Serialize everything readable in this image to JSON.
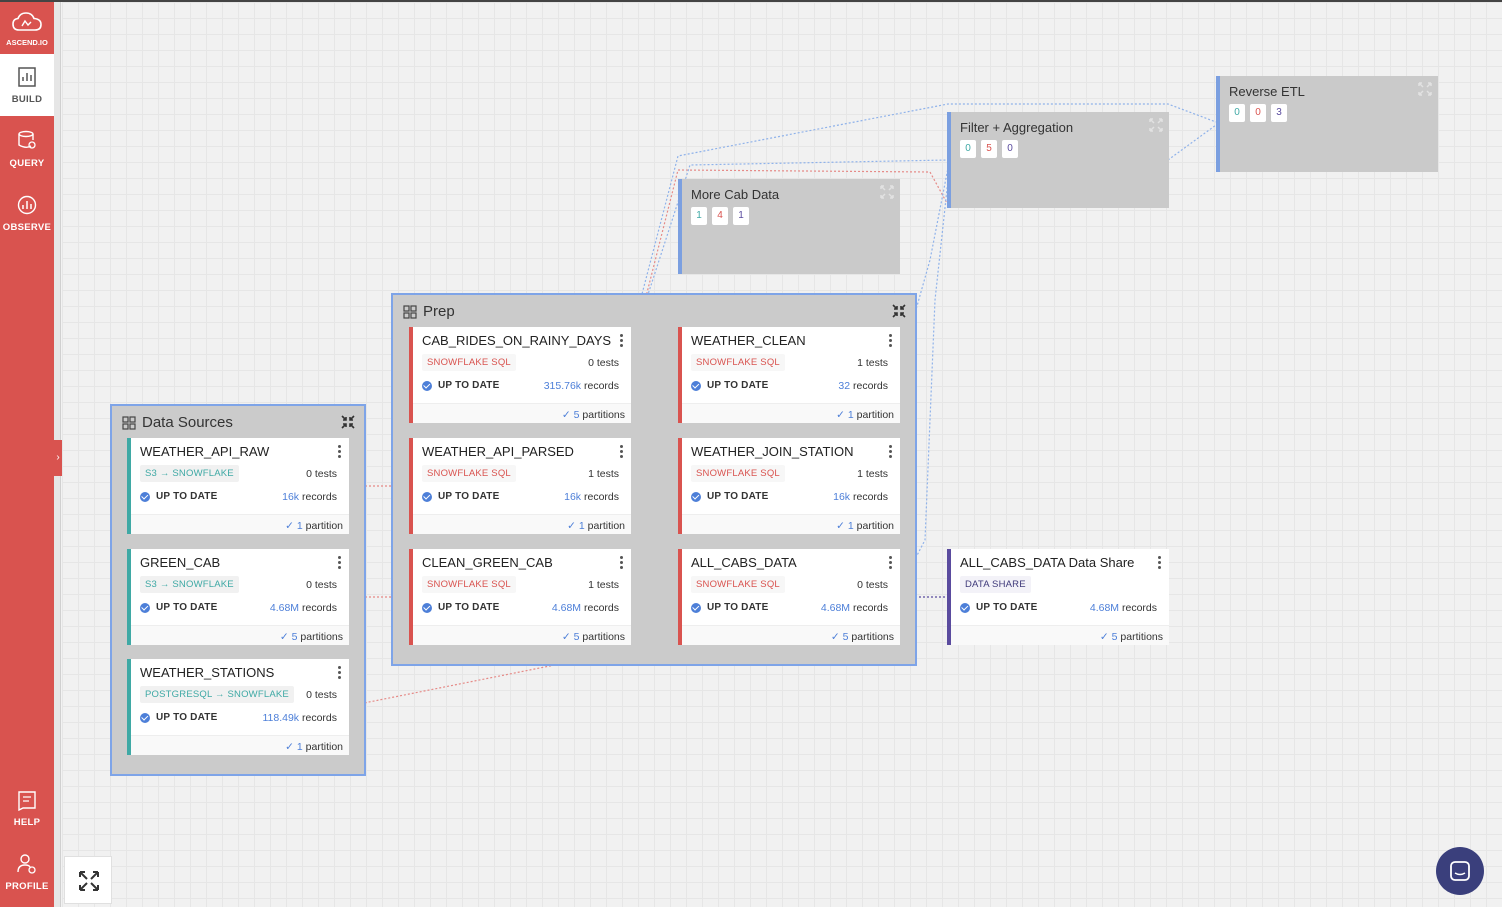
{
  "sidebar": {
    "logo_label": "ASCEND.IO",
    "items": [
      {
        "label": "BUILD",
        "icon": "build-icon"
      },
      {
        "label": "QUERY",
        "icon": "query-icon"
      },
      {
        "label": "OBSERVE",
        "icon": "observe-icon"
      },
      {
        "label": "HELP",
        "icon": "help-icon"
      },
      {
        "label": "PROFILE",
        "icon": "profile-icon"
      }
    ]
  },
  "groups": {
    "data_sources": {
      "title": "Data Sources"
    },
    "prep": {
      "title": "Prep"
    }
  },
  "subflows": {
    "more_cab_data": {
      "title": "More Cab Data",
      "counts": [
        "1",
        "4",
        "1"
      ]
    },
    "filter_aggregation": {
      "title": "Filter + Aggregation",
      "counts": [
        "0",
        "5",
        "0"
      ]
    },
    "reverse_etl": {
      "title": "Reverse ETL",
      "counts": [
        "0",
        "0",
        "3"
      ]
    }
  },
  "components": {
    "weather_api_raw": {
      "name": "WEATHER_API_RAW",
      "type": "S3 → SNOWFLAKE",
      "tests": "0 tests",
      "status": "UP TO DATE",
      "records_num": "16k",
      "records_label": "records",
      "parts_num": "1",
      "parts_label": "partition"
    },
    "green_cab": {
      "name": "GREEN_CAB",
      "type": "S3 → SNOWFLAKE",
      "tests": "0 tests",
      "status": "UP TO DATE",
      "records_num": "4.68M",
      "records_label": "records",
      "parts_num": "5",
      "parts_label": "partitions"
    },
    "weather_stations": {
      "name": "WEATHER_STATIONS",
      "type": "POSTGRESQL → SNOWFLAKE",
      "tests": "0 tests",
      "status": "UP TO DATE",
      "records_num": "118.49k",
      "records_label": "records",
      "parts_num": "1",
      "parts_label": "partition"
    },
    "cab_rides_on_rainy_days": {
      "name": "CAB_RIDES_ON_RAINY_DAYS",
      "type": "SNOWFLAKE SQL",
      "tests": "0 tests",
      "status": "UP TO DATE",
      "records_num": "315.76k",
      "records_label": "records",
      "parts_num": "5",
      "parts_label": "partitions"
    },
    "weather_api_parsed": {
      "name": "WEATHER_API_PARSED",
      "type": "SNOWFLAKE SQL",
      "tests": "1 tests",
      "status": "UP TO DATE",
      "records_num": "16k",
      "records_label": "records",
      "parts_num": "1",
      "parts_label": "partition"
    },
    "clean_green_cab": {
      "name": "CLEAN_GREEN_CAB",
      "type": "SNOWFLAKE SQL",
      "tests": "1 tests",
      "status": "UP TO DATE",
      "records_num": "4.68M",
      "records_label": "records",
      "parts_num": "5",
      "parts_label": "partitions"
    },
    "weather_clean": {
      "name": "WEATHER_CLEAN",
      "type": "SNOWFLAKE SQL",
      "tests": "1 tests",
      "status": "UP TO DATE",
      "records_num": "32",
      "records_label": "records",
      "parts_num": "1",
      "parts_label": "partition"
    },
    "weather_join_station": {
      "name": "WEATHER_JOIN_STATION",
      "type": "SNOWFLAKE SQL",
      "tests": "1 tests",
      "status": "UP TO DATE",
      "records_num": "16k",
      "records_label": "records",
      "parts_num": "1",
      "parts_label": "partition"
    },
    "all_cabs_data": {
      "name": "ALL_CABS_DATA",
      "type": "SNOWFLAKE SQL",
      "tests": "0 tests",
      "status": "UP TO DATE",
      "records_num": "4.68M",
      "records_label": "records",
      "parts_num": "5",
      "parts_label": "partitions"
    },
    "all_cabs_data_share": {
      "name": "ALL_CABS_DATA Data Share",
      "type": "DATA SHARE",
      "status": "UP TO DATE",
      "records_num": "4.68M",
      "records_label": "records",
      "parts_num": "5",
      "parts_label": "partitions"
    }
  },
  "colors": {
    "sidebar": "#d9534f",
    "accent_blue": "#4d7fd8",
    "connector_teal": "#3fa9a5",
    "data_share": "#5a4b9e",
    "group_border": "#7ea4e8"
  }
}
